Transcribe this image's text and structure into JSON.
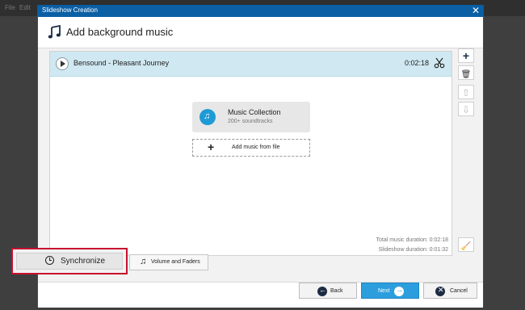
{
  "background": {
    "menu_items": [
      "File",
      "Edit"
    ]
  },
  "dialog": {
    "window_title": "Slideshow Creation",
    "close_glyph": "✕",
    "header_title": "Add background music"
  },
  "track": {
    "name": "Bensound - Pleasant Journey",
    "duration": "0:02:18"
  },
  "music_collection": {
    "title": "Music Collection",
    "subtitle": "200+ soundtracks"
  },
  "add_file": {
    "label": "Add music from file"
  },
  "totals": {
    "music_duration": "Total music duration: 0:02:18",
    "slideshow_duration": "Slideshow duration: 0:01:32"
  },
  "side_toolbar": {
    "add": "+",
    "delete": "🗑",
    "move_up": "⇧",
    "move_down": "⇩",
    "clean": "🧹"
  },
  "buttons": {
    "synchronize": "Synchronize",
    "volume_faders": "Volume and Faders",
    "back": "Back",
    "next": "Next",
    "cancel": "Cancel"
  },
  "colors": {
    "accent": "#0b5fa5",
    "track_highlight": "#cfe8f1",
    "next_button": "#2c9ede",
    "highlight_border": "#c8102e"
  }
}
